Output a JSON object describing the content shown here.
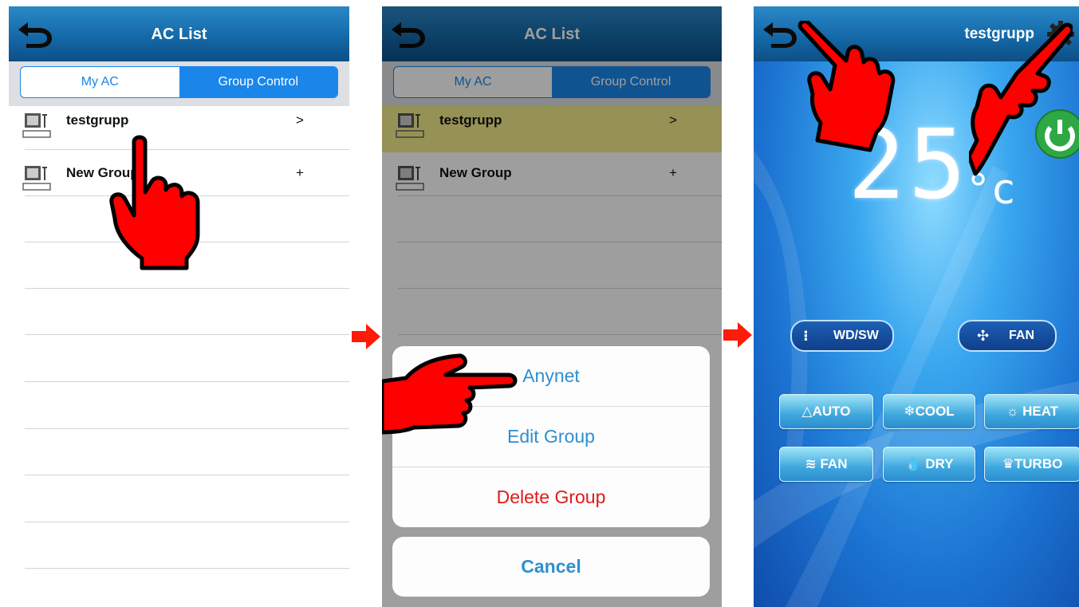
{
  "screen1": {
    "title": "AC List",
    "tabs": [
      "My AC",
      "Group Control"
    ],
    "rows": [
      {
        "name": "testgrupp",
        "action": ">"
      },
      {
        "name": "New Group",
        "action": "+"
      }
    ]
  },
  "screen2": {
    "title": "AC List",
    "tabs": [
      "My AC",
      "Group Control"
    ],
    "rows": [
      {
        "name": "testgrupp",
        "action": ">"
      },
      {
        "name": "New Group",
        "action": "+"
      }
    ],
    "sheet": {
      "items": [
        "Anynet",
        "Edit Group",
        "Delete Group"
      ],
      "cancel": "Cancel"
    }
  },
  "screen3": {
    "title": "testgrupp",
    "temperature": "25",
    "unit": "c",
    "buttons": {
      "wdsw": "WD/SW",
      "fan_speed": "FAN",
      "auto": "AUTO",
      "cool": "COOL",
      "heat": "HEAT",
      "fan": "FAN",
      "dry": "DRY",
      "turbo": "TURBO"
    }
  },
  "colors": {
    "accent": "#1a86ea",
    "delete": "#e21a1a",
    "hand": "#ff0000",
    "highlight": "#b9ad4e"
  },
  "icons": [
    "back-arrow-icon",
    "ac-unit-icon",
    "gear-icon",
    "power-icon",
    "pointing-hand-icon",
    "flow-arrow-icon"
  ]
}
